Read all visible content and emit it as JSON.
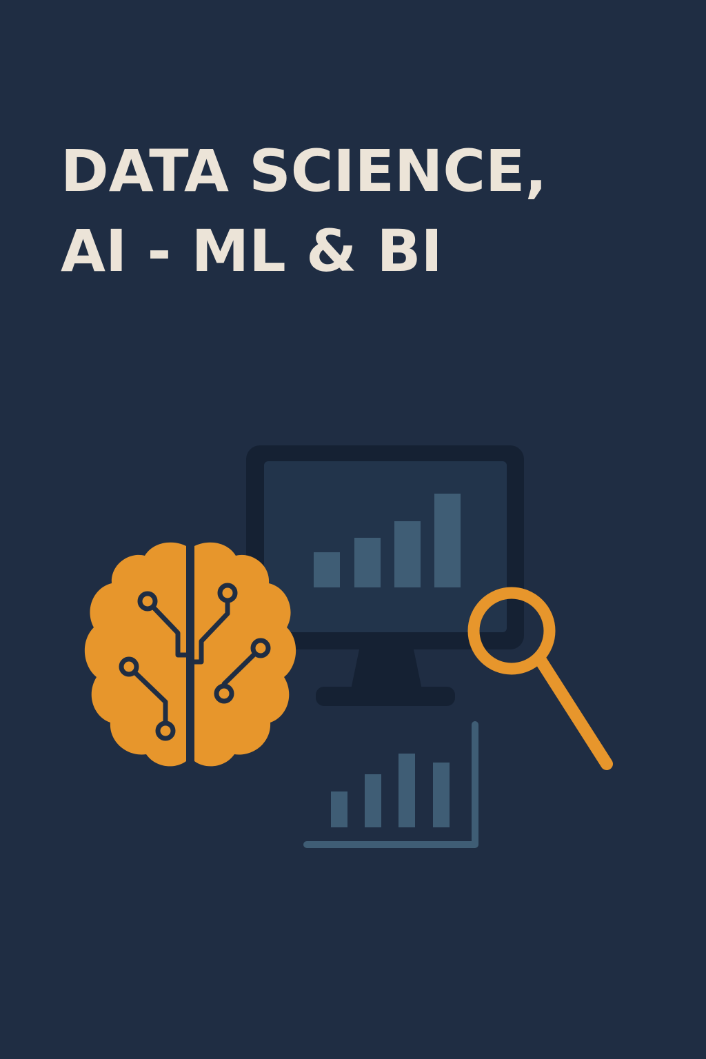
{
  "poster": {
    "title_line1": "DATA SCIENCE,",
    "title_line2": "AI - ML & BI"
  },
  "icons": [
    "monitor-icon",
    "bar-chart-icon",
    "brain-circuit-icon",
    "magnifying-glass-icon"
  ],
  "colors": {
    "background": "#1f2d43",
    "title": "#ece4d8",
    "accent_orange": "#e7962c",
    "bar_blue": "#3f5d75",
    "monitor_dark": "#152133",
    "screen": "#22344b"
  }
}
